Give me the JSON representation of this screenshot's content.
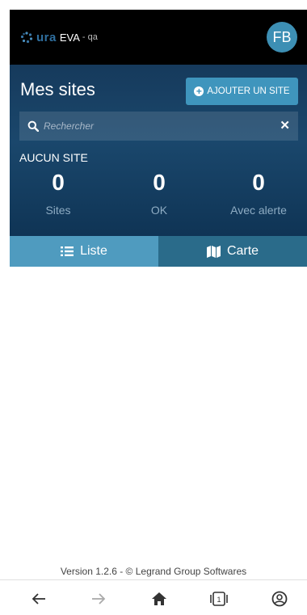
{
  "header": {
    "brand_word": "ura",
    "app_name": "EVA",
    "env": "- qa",
    "avatar_initials": "FB",
    "brand_color": "#2f6f9f",
    "avatar_color": "#3d8fb4"
  },
  "hero": {
    "title": "Mes sites",
    "add_button_label": "AJOUTER UN SITE",
    "search_placeholder": "Rechercher",
    "empty_label": "AUCUN SITE",
    "stats": [
      {
        "value": "0",
        "label": "Sites"
      },
      {
        "value": "0",
        "label": "OK"
      },
      {
        "value": "0",
        "label": "Avec alerte"
      }
    ]
  },
  "tabs": [
    {
      "label": "Liste",
      "icon": "list-icon",
      "active": true
    },
    {
      "label": "Carte",
      "icon": "map-icon",
      "active": false
    }
  ],
  "footer": {
    "version_text": "Version 1.2.6 - © Legrand Group Softwares"
  },
  "navbar": {
    "items": [
      "back-arrow-icon",
      "forward-arrow-icon",
      "home-icon",
      "tabs-count-icon",
      "account-icon"
    ],
    "tab_count": "1"
  }
}
